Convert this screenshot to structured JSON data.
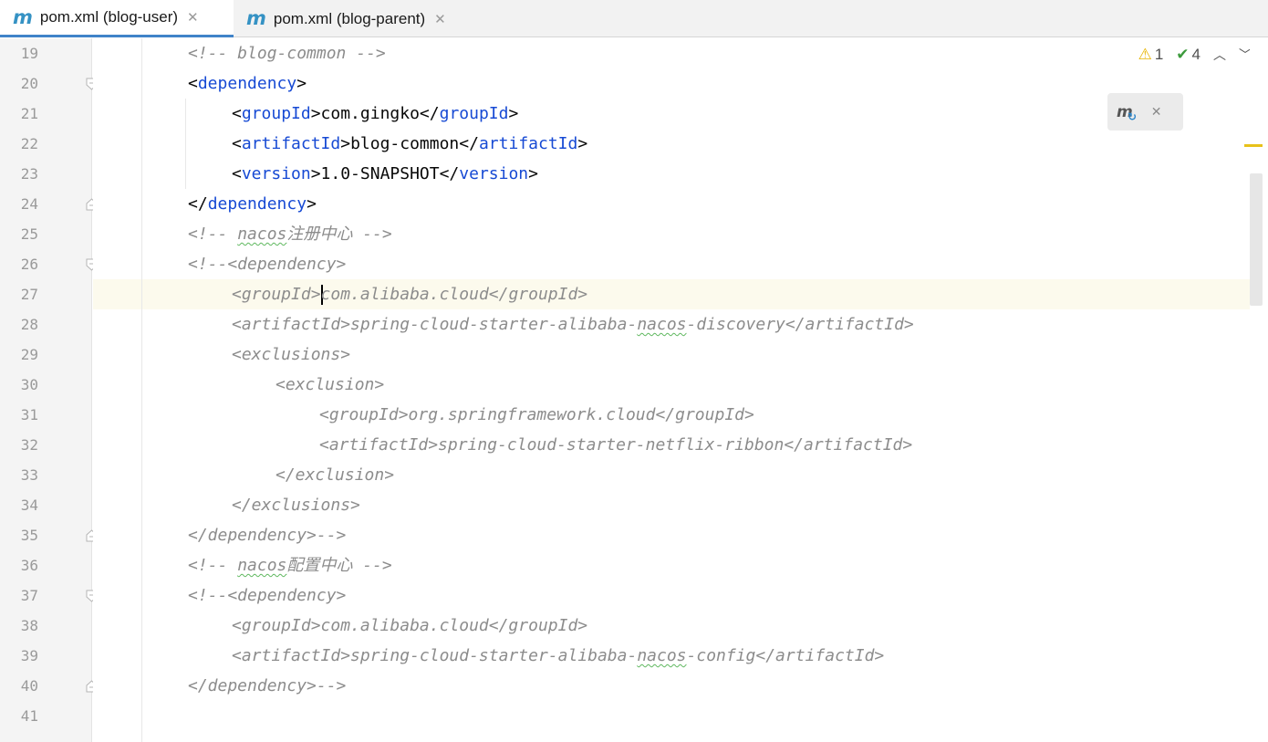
{
  "tabs": [
    {
      "icon": "maven-m-icon",
      "label": "pom.xml (blog-user)",
      "active": true
    },
    {
      "icon": "maven-m-icon",
      "label": "pom.xml (blog-parent)",
      "active": false
    }
  ],
  "inspections": {
    "warnings": "1",
    "weak_warnings": "4"
  },
  "caret_line_number": "27",
  "lines": [
    {
      "n": "19"
    },
    {
      "n": "20"
    },
    {
      "n": "21"
    },
    {
      "n": "22"
    },
    {
      "n": "23"
    },
    {
      "n": "24"
    },
    {
      "n": "25"
    },
    {
      "n": "26"
    },
    {
      "n": "27"
    },
    {
      "n": "28"
    },
    {
      "n": "29"
    },
    {
      "n": "30"
    },
    {
      "n": "31"
    },
    {
      "n": "32"
    },
    {
      "n": "33"
    },
    {
      "n": "34"
    },
    {
      "n": "35"
    },
    {
      "n": "36"
    },
    {
      "n": "37"
    },
    {
      "n": "38"
    },
    {
      "n": "39"
    },
    {
      "n": "40"
    },
    {
      "n": "41"
    }
  ],
  "code": {
    "l19": "<!-- blog-common -->",
    "l20_tag": "dependency",
    "l21_tag": "groupId",
    "l21_val": "com.gingko",
    "l22_tag": "artifactId",
    "l22_val": "blog-common",
    "l23_tag": "version",
    "l23_val": "1.0-SNAPSHOT",
    "l24_tag": "dependency",
    "l25_pre": "<!-- ",
    "l25_word": "nacos",
    "l25_cjk": "注册中心",
    "l25_post": " -->",
    "l26": "<!--<dependency>",
    "l27_open": "<groupId>",
    "l27_val": "com.alibaba.cloud</groupId>",
    "l28_pre": "<artifactId>spring-cloud-starter-alibaba-",
    "l28_word": "nacos",
    "l28_post": "-discovery</artifactId>",
    "l29": "<exclusions>",
    "l30": "<exclusion>",
    "l31": "<groupId>org.springframework.cloud</groupId>",
    "l32": "<artifactId>spring-cloud-starter-netflix-ribbon</artifactId>",
    "l33": "</exclusion>",
    "l34": "</exclusions>",
    "l35": "</dependency>-->",
    "l36_pre": "<!-- ",
    "l36_word": "nacos",
    "l36_cjk": "配置中心",
    "l36_post": " -->",
    "l37": "<!--<dependency>",
    "l38": "<groupId>com.alibaba.cloud</groupId>",
    "l39_pre": "<artifactId>spring-cloud-starter-alibaba-",
    "l39_word": "nacos",
    "l39_post": "-config</artifactId>",
    "l40": "</dependency>-->",
    "l41": ""
  }
}
